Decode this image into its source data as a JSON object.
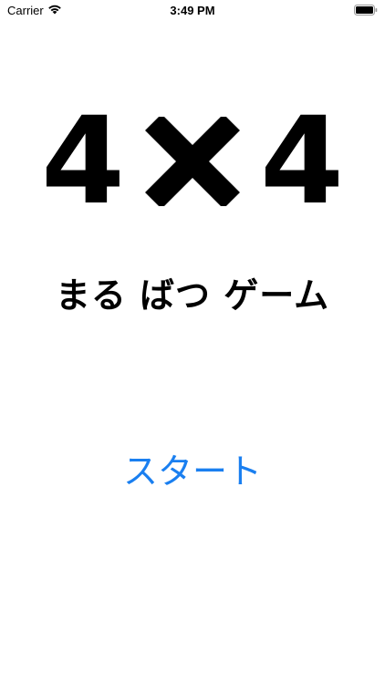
{
  "status_bar": {
    "carrier": "Carrier",
    "time": "3:49 PM"
  },
  "logo": {
    "left_digit": "4",
    "right_digit": "4",
    "symbol_icon": "cross-icon"
  },
  "title": "まる ばつ ゲーム",
  "start_button_label": "スタート",
  "colors": {
    "accent": "#1a7ff0",
    "text": "#000000",
    "background": "#ffffff"
  }
}
